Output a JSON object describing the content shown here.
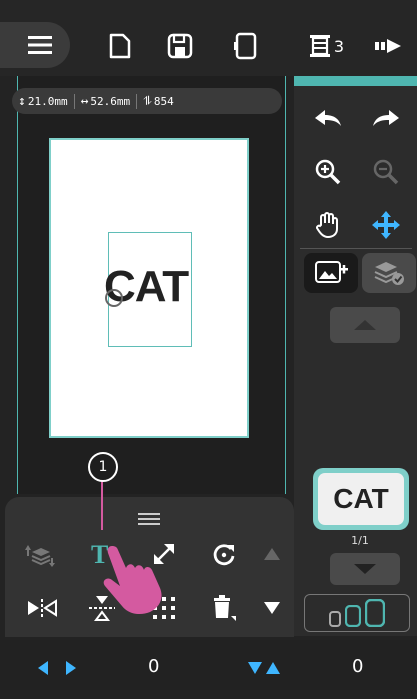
{
  "colors": {
    "accent": "#4fb6b0",
    "hand": "#d45aa0",
    "arrow_blue": "#3fb6ff",
    "background": "#232323"
  },
  "toolbar": {
    "icons": [
      "menu-icon",
      "new-file-icon",
      "save-icon",
      "hoop-icon",
      "thread-list-icon",
      "send-icon"
    ],
    "thread_count": "3"
  },
  "info": {
    "height": "21.0mm",
    "width": "52.6mm",
    "stitches": "854"
  },
  "canvas": {
    "text": "CAT"
  },
  "right_panel": {
    "thumbnail_text": "CAT",
    "page": "1/1"
  },
  "callout": {
    "number": "1"
  },
  "status": {
    "x_offset": "0",
    "y_offset": "0"
  }
}
